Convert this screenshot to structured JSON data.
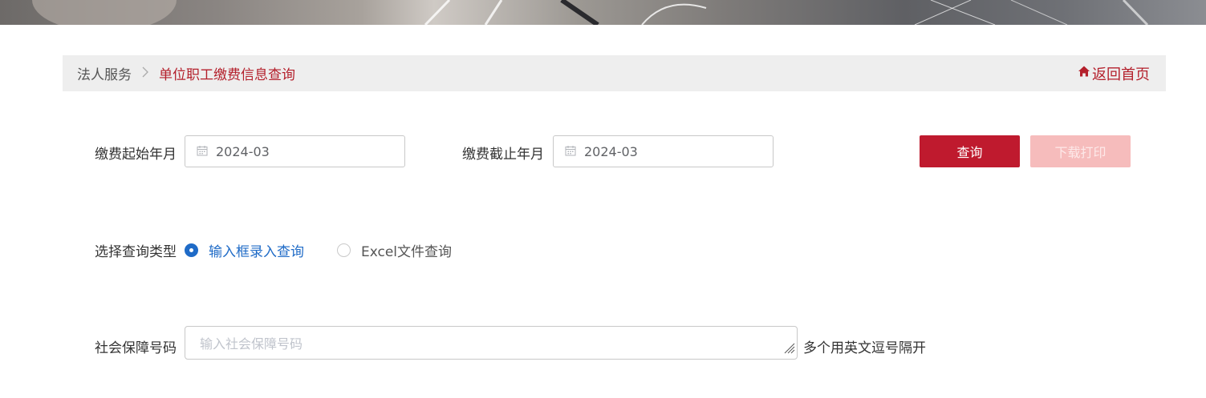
{
  "breadcrumb": {
    "root": "法人服务",
    "separator": ">",
    "current": "单位职工缴费信息查询",
    "home_link": "返回首页"
  },
  "form": {
    "start_label": "缴费起始年月",
    "start_value": "2024-03",
    "end_label": "缴费截止年月",
    "end_value": "2024-03",
    "query_button": "查询",
    "download_button": "下载打印",
    "type_label": "选择查询类型",
    "type_options": [
      {
        "label": "输入框录入查询",
        "checked": true
      },
      {
        "label": "Excel文件查询",
        "checked": false
      }
    ],
    "ssn_label": "社会保障号码",
    "ssn_placeholder": "输入社会保障号码",
    "ssn_hint": "多个用英文逗号隔开"
  },
  "colors": {
    "accent": "#bf1a2e",
    "accent_disabled": "#f6bcbc",
    "radio_selected": "#1f6bc7"
  }
}
